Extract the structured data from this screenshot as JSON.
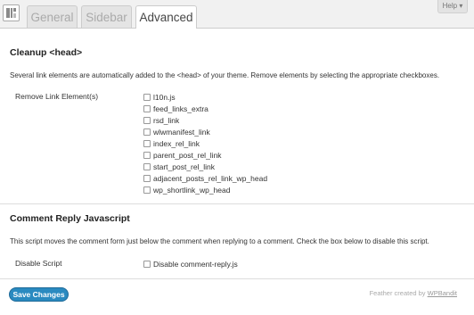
{
  "tabs": [
    {
      "label": "General"
    },
    {
      "label": "Sidebar"
    },
    {
      "label": "Advanced"
    }
  ],
  "help": {
    "label": "Help ▾"
  },
  "cleanup": {
    "title": "Cleanup <head>",
    "description": "Several link elements are automatically added to the <head> of your theme. Remove elements by selecting the appropriate checkboxes.",
    "label": "Remove Link Element(s)",
    "options": [
      {
        "label": "l10n.js",
        "checked": false
      },
      {
        "label": "feed_links_extra",
        "checked": false
      },
      {
        "label": "rsd_link",
        "checked": false
      },
      {
        "label": "wlwmanifest_link",
        "checked": false
      },
      {
        "label": "index_rel_link",
        "checked": false
      },
      {
        "label": "parent_post_rel_link",
        "checked": false
      },
      {
        "label": "start_post_rel_link",
        "checked": false
      },
      {
        "label": "adjacent_posts_rel_link_wp_head",
        "checked": false
      },
      {
        "label": "wp_shortlink_wp_head",
        "checked": false
      }
    ]
  },
  "comment_reply": {
    "title": "Comment Reply Javascript",
    "description": "This script moves the comment form just below the comment when replying to a comment. Check the box below to disable this script.",
    "label": "Disable Script",
    "option": {
      "label": "Disable comment-reply.js",
      "checked": false
    }
  },
  "save_button": {
    "label": "Save Changes"
  },
  "footer": {
    "prefix": "Feather created by ",
    "link": "WPBandit"
  },
  "colors": {
    "accent": "#2a8ac0",
    "background": "#f1f1f1",
    "panel": "#ffffff"
  },
  "icons": {
    "app": "feather-settings-icon",
    "checkbox": "checkbox-icon"
  }
}
